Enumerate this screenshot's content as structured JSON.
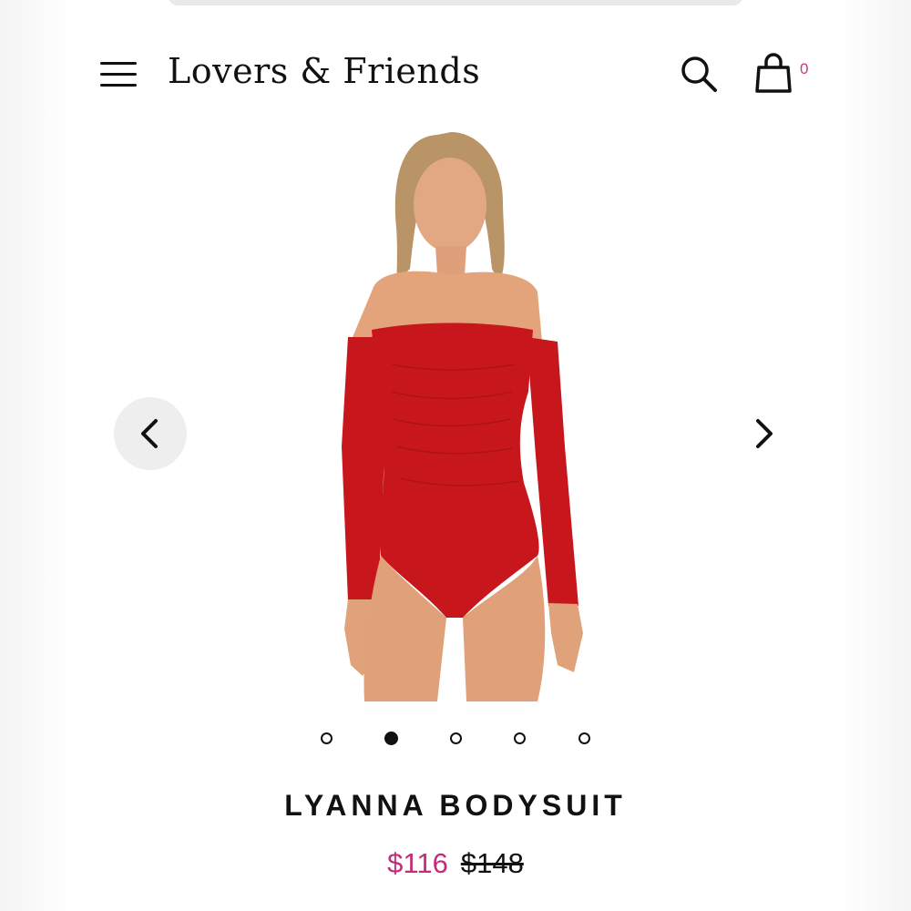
{
  "header": {
    "brand": "Lovers & Friends",
    "cart_count": "0"
  },
  "product": {
    "title": "LYANNA BODYSUIT",
    "price_sale": "$116",
    "price_original": "$148",
    "color": "#c8161d"
  },
  "carousel": {
    "total_slides": 5,
    "active_slide": 2
  },
  "colors": {
    "accent": "#c72a7a",
    "garment": "#c8161d"
  },
  "icons": {
    "menu": "hamburger-icon",
    "search": "search-icon",
    "bag": "shopping-bag-icon",
    "prev": "chevron-left-icon",
    "next": "chevron-right-icon"
  }
}
